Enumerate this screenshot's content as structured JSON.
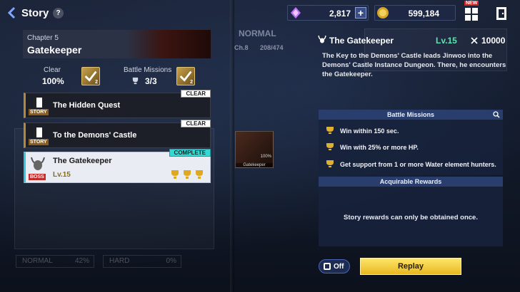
{
  "header": {
    "title": "Story",
    "help_label": "?",
    "currency_gems": "2,817",
    "currency_gold": "599,184",
    "plus_label": "+",
    "new_badge": "NEW"
  },
  "chapter": {
    "subtitle": "Chapter 5",
    "name": "Gatekeeper",
    "clear_label": "Clear",
    "clear_value": "100%",
    "clear_badge": "2",
    "missions_label": "Battle Missions",
    "missions_value": "3/3",
    "missions_badge": "2"
  },
  "quests": [
    {
      "name": "The Hidden Quest",
      "tag": "STORY",
      "status": "CLEAR"
    },
    {
      "name": "To the Demons' Castle",
      "tag": "STORY",
      "status": "CLEAR"
    },
    {
      "name": "The Gatekeeper",
      "tag": "BOSS",
      "status": "COMPLETE",
      "level": "Lv.15"
    }
  ],
  "bottom_left": {
    "normal": "NORMAL",
    "normal_pct": "42%",
    "hard": "HARD",
    "hard_pct": "0%"
  },
  "middle": {
    "mode": "NORMAL",
    "chapter": "Ch.8",
    "progress": "208/474",
    "thumb_label": "Gatekeeper",
    "thumb_pct": "100%"
  },
  "detail": {
    "title": "The Gatekeeper",
    "level": "Lv.15",
    "power": "10000",
    "description": "The Key to the Demons' Castle leads Jinwoo into the Demons' Castle Instance Dungeon. There, he encounters the Gatekeeper.",
    "missions_heading": "Battle Missions",
    "missions": [
      "Win within 150 sec.",
      "Win with 25% or more HP.",
      "Get support from 1 or more Water element hunters."
    ],
    "rewards_heading": "Acquirable Rewards",
    "rewards_note": "Story rewards can only be obtained once."
  },
  "controls": {
    "toggle_label": "Off",
    "replay_label": "Replay"
  },
  "colors": {
    "accent_level": "#5fe3b0",
    "complete": "#35d9d4",
    "replay": "#f2cd3a",
    "boss_tag": "#c32a2a"
  }
}
